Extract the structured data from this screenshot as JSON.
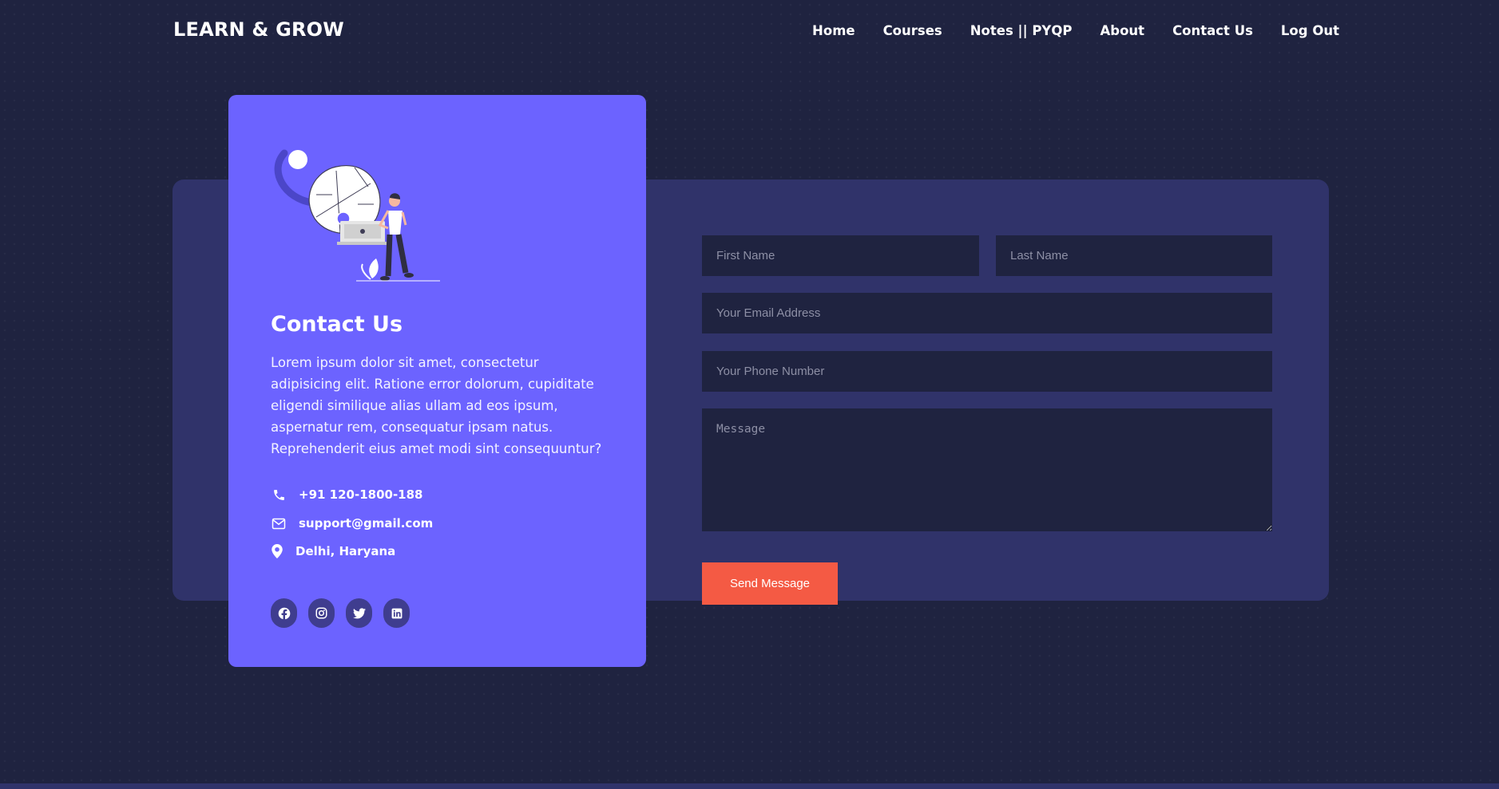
{
  "brand": "LEARN & GROW",
  "nav": [
    "Home",
    "Courses",
    "Notes || PYQP",
    "About",
    "Contact Us",
    "Log Out"
  ],
  "card": {
    "title": "Contact Us",
    "description": "Lorem ipsum dolor sit amet, consectetur adipisicing elit. Ratione error dolorum, cupiditate eligendi similique alias ullam ad eos ipsum, aspernatur rem, consequatur ipsam natus. Reprehenderit eius amet modi sint consequuntur?",
    "phone": "+91 120-1800-188",
    "email": "support@gmail.com",
    "location": "Delhi, Haryana",
    "socials": [
      "facebook-icon",
      "instagram-icon",
      "twitter-icon",
      "linkedin-icon"
    ]
  },
  "form": {
    "first_name_placeholder": "First Name",
    "last_name_placeholder": "Last Name",
    "email_placeholder": "Your Email Address",
    "phone_placeholder": "Your Phone Number",
    "message_placeholder": "Message",
    "submit_label": "Send Message"
  },
  "colors": {
    "background": "#1f2340",
    "panel": "#30336a",
    "card": "#6c63ff",
    "button": "#f45a44"
  }
}
